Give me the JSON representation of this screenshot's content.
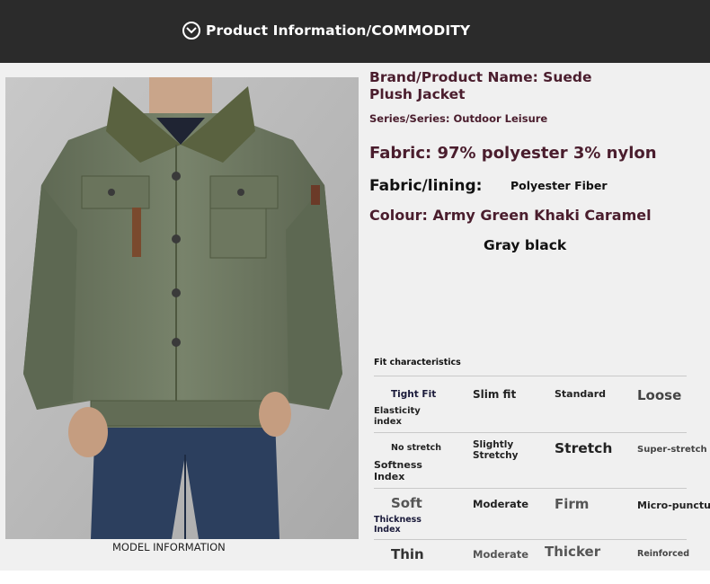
{
  "header": {
    "title": "Product Information/COMMODITY",
    "icon": "chevron-down-circle-icon"
  },
  "model_caption": "MODEL INFORMATION",
  "product": {
    "brand_line1": "Brand/Product Name: Suede",
    "brand_line2": "Plush Jacket",
    "series": "Series/Series: Outdoor Leisure",
    "fabric": "Fabric: 97% polyester 3% nylon",
    "lining_label": "Fabric/lining:",
    "lining_value": "Polyester Fiber",
    "colour": "Colour: Army Green Khaki Caramel",
    "colour_line2": "Gray black"
  },
  "fit": {
    "title": "Fit characteristics",
    "fit_row": [
      "Tight Fit",
      "Slim fit",
      "Standard",
      "Loose"
    ],
    "elasticity_label": [
      "Elasticity",
      "index"
    ],
    "elasticity_row": [
      "No stretch",
      "Slightly Stretchy",
      "Stretch",
      "Super-stretch"
    ],
    "softness_label": [
      "Softness",
      "Index"
    ],
    "softness_row": [
      "Soft",
      "Moderate",
      "Firm",
      "Micro-puncture"
    ],
    "thickness_label": [
      "Thickness",
      "Index"
    ],
    "thickness_row": [
      "Thin",
      "Moderate",
      "Thicker",
      "Reinforced"
    ]
  },
  "colors": {
    "header_bg": "#2b2b2b",
    "panel_bg": "#f0f0f0",
    "accent_text": "#4a1d2d",
    "jacket": "#6f7a62"
  }
}
